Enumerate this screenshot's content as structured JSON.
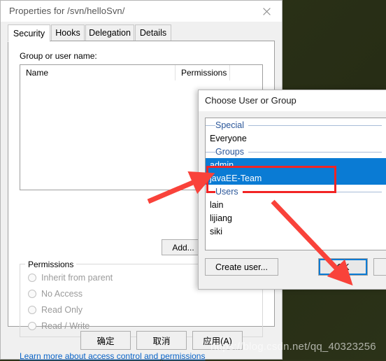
{
  "desktop": {
    "background_color": "#2d3319"
  },
  "properties_dialog": {
    "title": "Properties for /svn/helloSvn/",
    "close_icon": "close-icon",
    "tabs": [
      {
        "label": "Security",
        "active": true
      },
      {
        "label": "Hooks",
        "active": false
      },
      {
        "label": "Delegation",
        "active": false
      },
      {
        "label": "Details",
        "active": false
      }
    ],
    "group_label": "Group or user name:",
    "listview": {
      "columns": [
        "Name",
        "Permissions",
        ""
      ],
      "rows": []
    },
    "add_button": "Add...",
    "permissions": {
      "legend": "Permissions",
      "options": [
        {
          "label": "Inherit from parent",
          "selected": false,
          "disabled": true
        },
        {
          "label": "No Access",
          "selected": false,
          "disabled": true
        },
        {
          "label": "Read Only",
          "selected": false,
          "disabled": true
        },
        {
          "label": "Read / Write",
          "selected": false,
          "disabled": true
        }
      ]
    },
    "help_link": "Learn more about access control and permissions",
    "buttons": [
      {
        "label": "确定",
        "name": "ok-button"
      },
      {
        "label": "取消",
        "name": "cancel-button"
      },
      {
        "label": "应用(A)",
        "name": "apply-button"
      }
    ]
  },
  "choose_dialog": {
    "title": "Choose User or Group",
    "list": [
      {
        "type": "header",
        "label": "Special"
      },
      {
        "type": "item",
        "label": "Everyone",
        "selected": false
      },
      {
        "type": "header",
        "label": "Groups"
      },
      {
        "type": "item",
        "label": "admin",
        "selected": true
      },
      {
        "type": "item",
        "label": "javaEE-Team",
        "selected": true
      },
      {
        "type": "header",
        "label": "Users"
      },
      {
        "type": "item",
        "label": "lain",
        "selected": false
      },
      {
        "type": "item",
        "label": "lijiang",
        "selected": false
      },
      {
        "type": "item",
        "label": "siki",
        "selected": false
      }
    ],
    "create_user_button": "Create user...",
    "ok_button": "OK",
    "cancel_button": "",
    "selection_color": "#0a7bd4",
    "header_color": "#2a5699"
  },
  "annotations": {
    "highlight_color": "#f22424",
    "arrow_count": 2,
    "arrow_1_note": "from Add... button to selected groups",
    "arrow_2_note": "from groups area to OK button"
  },
  "watermark": {
    "text": "https://blog.csdn.net/qq_40323256"
  }
}
